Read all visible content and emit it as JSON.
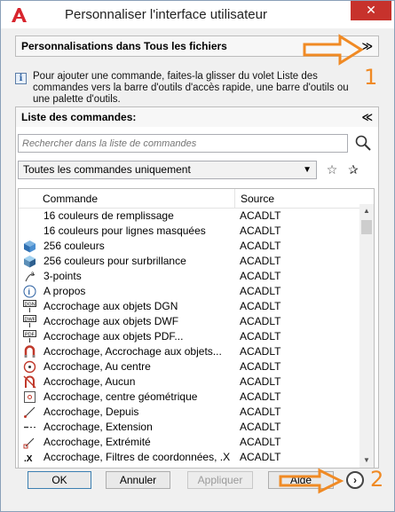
{
  "window": {
    "title": "Personnaliser l'interface utilisateur",
    "close_glyph": "✕"
  },
  "customizations": {
    "header": "Personnalisations dans Tous les fichiers",
    "chevron": "≫"
  },
  "info": {
    "text": "Pour ajouter une commande, faites-la glisser du volet Liste des commandes vers la barre d'outils d'accès rapide, une barre d'outils ou une palette d'outils."
  },
  "command_list": {
    "header": "Liste des commandes:",
    "chevron": "≪",
    "search_placeholder": "Rechercher dans la liste de commandes",
    "filter_selected": "Toutes les commandes uniquement",
    "columns": {
      "command": "Commande",
      "source": "Source"
    },
    "rows": [
      {
        "command": "16 couleurs de remplissage",
        "source": "ACADLT",
        "icon": "none"
      },
      {
        "command": "16 couleurs pour lignes masquées",
        "source": "ACADLT",
        "icon": "none"
      },
      {
        "command": "256 couleurs",
        "source": "ACADLT",
        "icon": "cube-shaded-icon"
      },
      {
        "command": "256 couleurs pour surbrillance",
        "source": "ACADLT",
        "icon": "cube-highlight-icon"
      },
      {
        "command": "3-points",
        "source": "ACADLT",
        "icon": "three-points-icon"
      },
      {
        "command": "A propos",
        "source": "ACADLT",
        "icon": "info-icon"
      },
      {
        "command": "Accrochage aux objets DGN",
        "source": "ACADLT",
        "icon": "dgn-snap-icon"
      },
      {
        "command": "Accrochage aux objets DWF",
        "source": "ACADLT",
        "icon": "dwf-snap-icon"
      },
      {
        "command": "Accrochage aux objets PDF...",
        "source": "ACADLT",
        "icon": "pdf-snap-icon"
      },
      {
        "command": "Accrochage, Accrochage aux objets...",
        "source": "ACADLT",
        "icon": "magnet-icon"
      },
      {
        "command": "Accrochage, Au centre",
        "source": "ACADLT",
        "icon": "center-snap-icon"
      },
      {
        "command": "Accrochage, Aucun",
        "source": "ACADLT",
        "icon": "no-snap-icon"
      },
      {
        "command": "Accrochage, centre géométrique",
        "source": "ACADLT",
        "icon": "geometric-center-icon"
      },
      {
        "command": "Accrochage, Depuis",
        "source": "ACADLT",
        "icon": "from-snap-icon"
      },
      {
        "command": "Accrochage, Extension",
        "source": "ACADLT",
        "icon": "extension-snap-icon"
      },
      {
        "command": "Accrochage, Extrémité",
        "source": "ACADLT",
        "icon": "endpoint-snap-icon"
      },
      {
        "command": "Accrochage, Filtres de coordonnées, .X",
        "source": "ACADLT",
        "icon": "filter-x-icon"
      }
    ]
  },
  "buttons": {
    "ok": "OK",
    "cancel": "Annuler",
    "apply": "Appliquer",
    "help": "Aide"
  },
  "annotations": {
    "one": "1",
    "two": "2"
  },
  "colors": {
    "annotation": "#f08a24",
    "close": "#c7322c",
    "accent": "#3c7fb1"
  }
}
